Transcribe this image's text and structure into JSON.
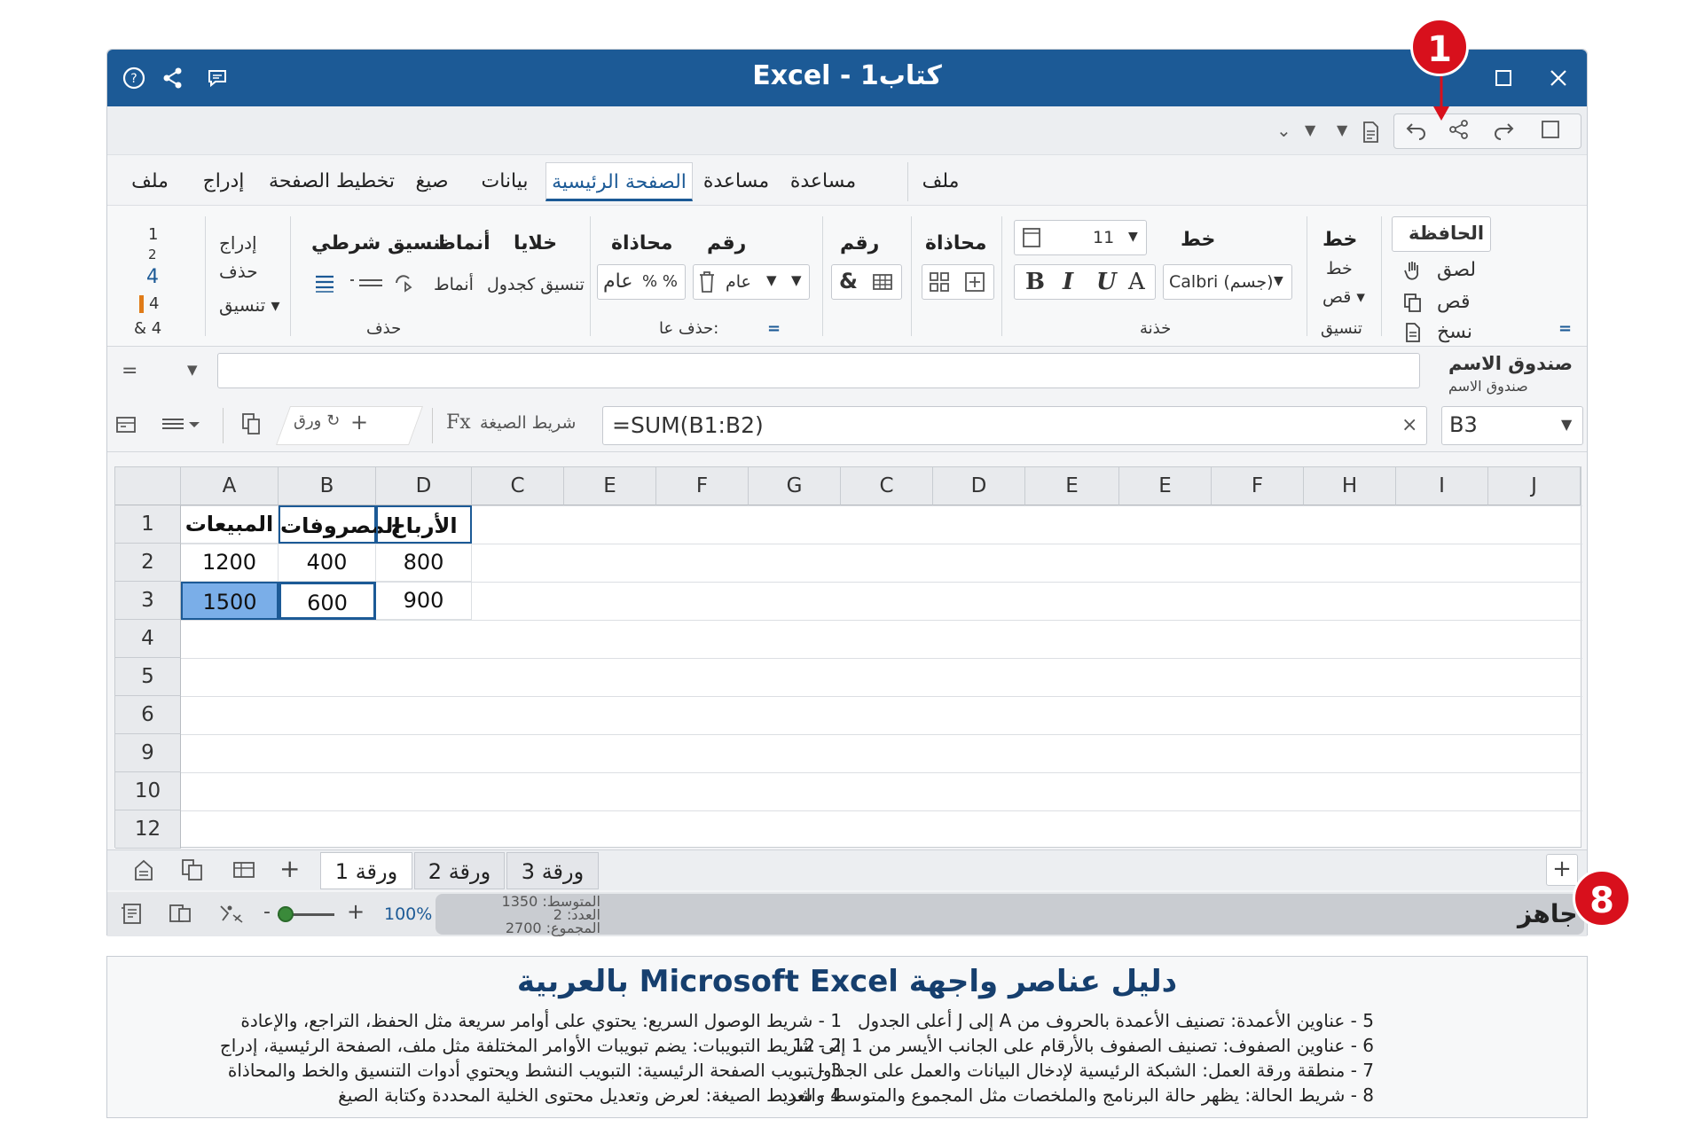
{
  "window": {
    "title": "Excel - كتاب1"
  },
  "qat": {
    "dropdown": "⌄"
  },
  "tabs": [
    "ملف",
    "إدراج",
    "تخطيط الصفحة",
    "صيغ",
    "بيانات",
    "الصفحة الرئيسية",
    "مساعدة",
    "مساعدة",
    "ملف"
  ],
  "ribbon": {
    "clipboard": {
      "title": "الحافظة",
      "paste": "لصق",
      "cut": "قص",
      "copy": "نسخ"
    },
    "font_small": {
      "a": "خط",
      "b": "خط",
      "c": "قص",
      "label": "تنسيق"
    },
    "font": {
      "header": "خط",
      "size": "11",
      "name": "Calbri (جسم)",
      "bold": "B",
      "italic": "I",
      "underline": "U",
      "a": "A",
      "label": "خذنة"
    },
    "align2": {
      "header": "محاذاة"
    },
    "number2": {
      "header": "رقم",
      "amp": "&"
    },
    "number": {
      "header": "رقم",
      "format": "عام"
    },
    "align": {
      "header": "محاذاة",
      "format": "عام",
      "pct": "% %",
      "label": "حذف عا:",
      "eq": "="
    },
    "cells": {
      "header": "خلايا",
      "styles": "أنماط",
      "cond": "تنسيق شرطي",
      "styles2": "أنماط",
      "table": "تنسيق كجدول",
      "label": "حذف"
    },
    "edit": {
      "insert": "إدراج",
      "delete": "حذف",
      "format": "تنسيق"
    },
    "leftcol": [
      "1",
      "2",
      "4",
      "4",
      "& 4"
    ]
  },
  "namebar": {
    "label": "صندوق الاسم",
    "sub": "صندوق الاسم",
    "eq": "="
  },
  "formula": {
    "namebox": "B3",
    "close": "×",
    "content": "=SUM(B1:B2)",
    "label": "شريط الصيغة",
    "fx": "Fx",
    "plus": "+",
    "tabtxt": "ورق"
  },
  "grid": {
    "cols": [
      "A",
      "B",
      "D",
      "C",
      "E",
      "F",
      "G",
      "C",
      "D",
      "E",
      "E",
      "F",
      "H",
      "I",
      "J"
    ],
    "rows": [
      "1",
      "2",
      "3",
      "4",
      "5",
      "6",
      "9",
      "10",
      "12"
    ],
    "cells": [
      [
        "المبيعات",
        "المصروفات",
        "الأرباح"
      ],
      [
        "1200",
        "400",
        "800"
      ],
      [
        "1500",
        "600",
        "900"
      ]
    ]
  },
  "sheets": [
    "ورقة 1",
    "ورقة 2",
    "ورقة 3"
  ],
  "sheetbar": {
    "add": "+",
    "addr": "+"
  },
  "status": {
    "ready": "جاهز",
    "avg": "المتوسط: 1350",
    "count": "العدد: 2",
    "sum": "المجموع: 2700",
    "zoom": "100%",
    "minus": "-",
    "plus": "+"
  },
  "legend": {
    "title": "دليل عناصر واجهة Microsoft Excel بالعربية",
    "right": [
      "1 - شريط الوصول السريع: يحتوي على أوامر سريعة مثل الحفظ، التراجع، والإعادة",
      "2 - شريط التبويبات: يضم تبويبات الأوامر المختلفة مثل ملف، الصفحة الرئيسية، إدراج",
      "3 - تبويب الصفحة الرئيسية: التبويب النشط ويحتوي أدوات التنسيق والخط والمحاذاة",
      "4 - شريط الصيغة: لعرض وتعديل محتوى الخلية المحددة وكتابة الصيغ"
    ],
    "left": [
      "5 - عناوين الأعمدة: تصنيف الأعمدة بالحروف من A إلى J أعلى الجدول",
      "6 - عناوين الصفوف: تصنيف الصفوف بالأرقام على الجانب الأيسر من 1 إلى 12",
      "7 - منطقة ورقة العمل: الشبكة الرئيسية لإدخال البيانات والعمل على الجداول",
      "8 - شريط الحالة: يظهر حالة البرنامج والملخصات مثل المجموع والمتوسط والعدد"
    ]
  },
  "badges": {
    "b1": "1",
    "b8": "8"
  },
  "colors": {
    "title_bar": "#1c5a96",
    "accent": "#1c5a96",
    "badge": "#d8101c",
    "selection": "#7aaee8"
  }
}
